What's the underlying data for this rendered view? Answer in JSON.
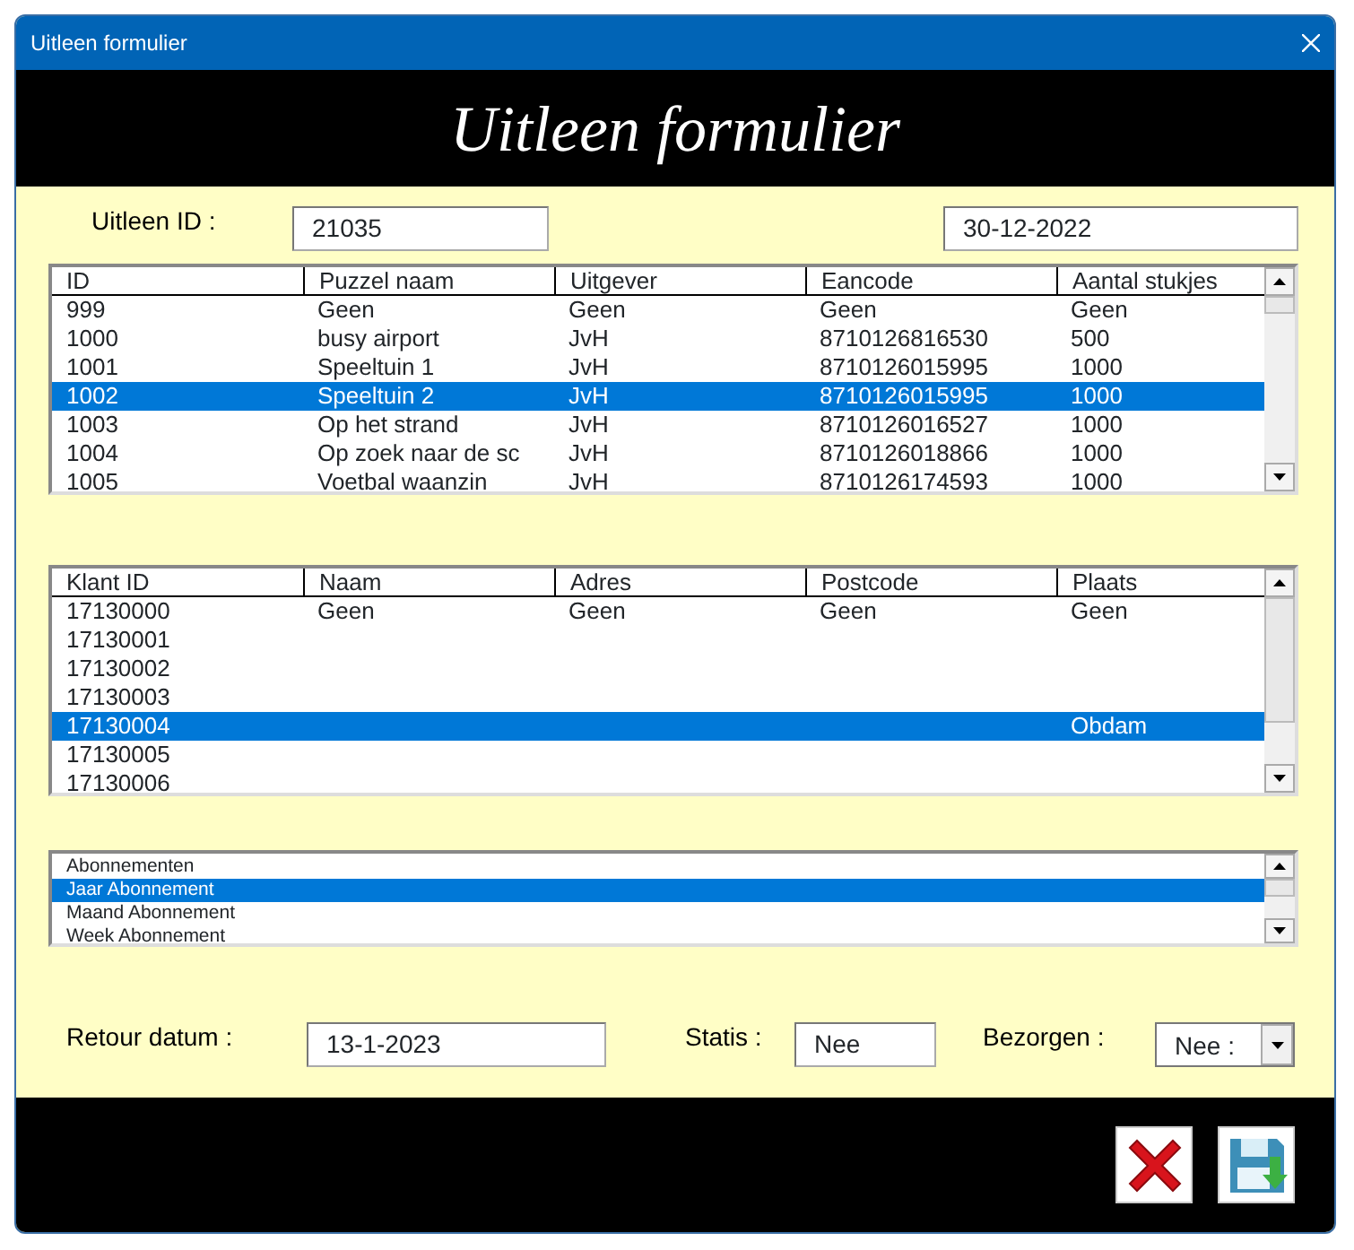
{
  "window": {
    "title": "Uitleen formulier"
  },
  "header": {
    "title": "Uitleen formulier"
  },
  "loan_id": {
    "label": "Uitleen ID :",
    "value": "21035"
  },
  "date": {
    "value": "30-12-2022"
  },
  "puzzle_table": {
    "columns": [
      "ID",
      "Puzzel naam",
      "Uitgever",
      "Eancode",
      "Aantal stukjes"
    ],
    "rows": [
      {
        "cells": [
          "999",
          "Geen",
          "Geen",
          "Geen",
          "Geen"
        ],
        "selected": false
      },
      {
        "cells": [
          "1000",
          "busy airport",
          "JvH",
          "8710126816530",
          "500"
        ],
        "selected": false
      },
      {
        "cells": [
          "1001",
          "Speeltuin 1",
          "JvH",
          "8710126015995",
          "1000"
        ],
        "selected": false
      },
      {
        "cells": [
          "1002",
          "Speeltuin 2",
          "JvH",
          "8710126015995",
          "1000"
        ],
        "selected": true
      },
      {
        "cells": [
          "1003",
          "Op het strand",
          "JvH",
          "8710126016527",
          "1000"
        ],
        "selected": false
      },
      {
        "cells": [
          "1004",
          "Op zoek naar de sc",
          "JvH",
          "8710126018866",
          "1000"
        ],
        "selected": false
      },
      {
        "cells": [
          "1005",
          "Voetbal waanzin",
          "JvH",
          "8710126174593",
          "1000"
        ],
        "selected": false
      }
    ]
  },
  "customer_table": {
    "columns": [
      "Klant ID",
      "Naam",
      "Adres",
      "Postcode",
      "Plaats"
    ],
    "rows": [
      {
        "cells": [
          "17130000",
          "Geen",
          "Geen",
          "Geen",
          "Geen"
        ],
        "selected": false
      },
      {
        "cells": [
          "17130001",
          null,
          null,
          null,
          null
        ],
        "selected": false
      },
      {
        "cells": [
          "17130002",
          null,
          null,
          null,
          null
        ],
        "selected": false
      },
      {
        "cells": [
          "17130003",
          null,
          null,
          null,
          null
        ],
        "selected": false
      },
      {
        "cells": [
          "17130004",
          null,
          null,
          null,
          "Obdam"
        ],
        "selected": true
      },
      {
        "cells": [
          "17130005",
          null,
          null,
          null,
          null
        ],
        "selected": false
      },
      {
        "cells": [
          "17130006",
          null,
          null,
          null,
          null
        ],
        "selected": false
      }
    ]
  },
  "subscriptions": [
    {
      "label": "Abonnementen",
      "selected": false
    },
    {
      "label": "Jaar Abonnement",
      "selected": true
    },
    {
      "label": "Maand Abonnement",
      "selected": false
    },
    {
      "label": "Week Abonnement",
      "selected": false
    }
  ],
  "return_date": {
    "label": "Retour datum :",
    "value": "13-1-2023"
  },
  "status": {
    "label": "Statis :",
    "value": "Nee"
  },
  "delivered": {
    "label": "Bezorgen :",
    "value": "Nee :"
  },
  "actions": [
    {
      "kind": "cancel"
    },
    {
      "kind": "save"
    }
  ]
}
